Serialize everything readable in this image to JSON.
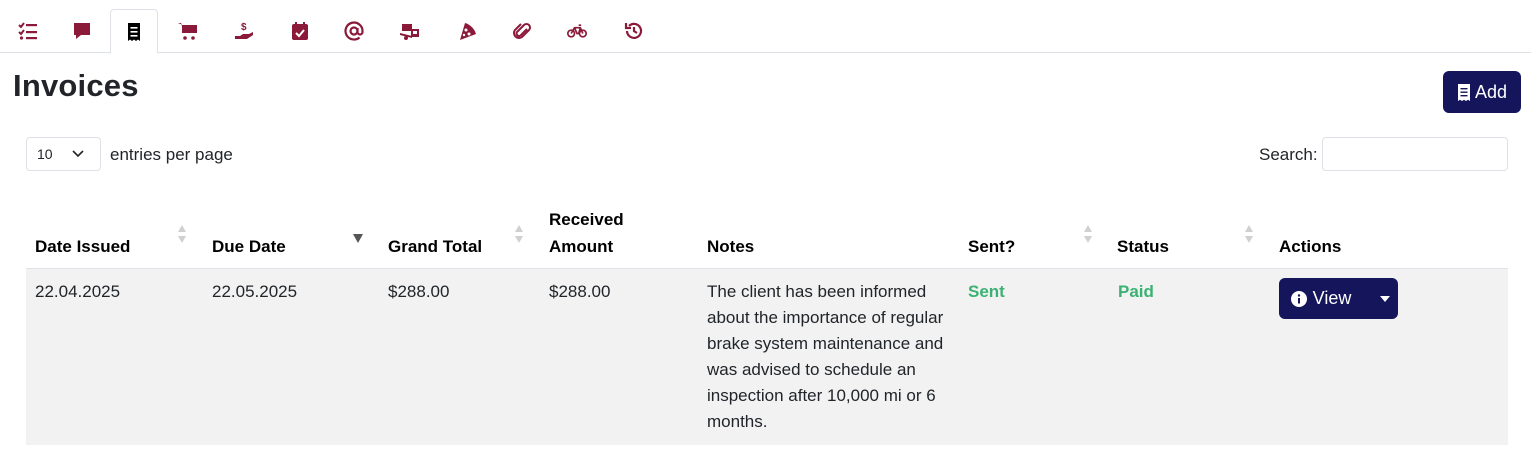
{
  "colors": {
    "tab_icon": "#8b1a3a",
    "primary": "#14155a",
    "success": "#3bb273",
    "row_bg": "#f2f2f2"
  },
  "tabs": [
    {
      "icon": "checklist-icon"
    },
    {
      "icon": "comment-icon"
    },
    {
      "icon": "receipt-icon",
      "active": true
    },
    {
      "icon": "cart-icon"
    },
    {
      "icon": "hand-dollar-icon"
    },
    {
      "icon": "calendar-check-icon"
    },
    {
      "icon": "at-icon"
    },
    {
      "icon": "truck-ramp-icon"
    },
    {
      "icon": "pizza-slice-icon"
    },
    {
      "icon": "paperclip-icon"
    },
    {
      "icon": "bicycle-icon"
    },
    {
      "icon": "history-icon"
    }
  ],
  "page": {
    "title": "Invoices",
    "add_label": "Add"
  },
  "controls": {
    "entries_value": "10",
    "entries_label": "entries per page",
    "search_label": "Search:"
  },
  "table": {
    "headers": {
      "date_issued": "Date Issued",
      "due_date": "Due Date",
      "grand_total": "Grand Total",
      "received_line1": "Received",
      "received_line2": "Amount",
      "notes": "Notes",
      "sent": "Sent?",
      "status": "Status",
      "actions": "Actions"
    },
    "rows": [
      {
        "date_issued": "22.04.2025",
        "due_date": "22.05.2025",
        "grand_total": "$288.00",
        "received": "$288.00",
        "notes": "The client has been informed about the importance of regular brake system maintenance and was advised to schedule an inspection after 10,000 mi or 6 months.",
        "sent": "Sent",
        "status": "Paid",
        "action_label": "View"
      }
    ]
  }
}
